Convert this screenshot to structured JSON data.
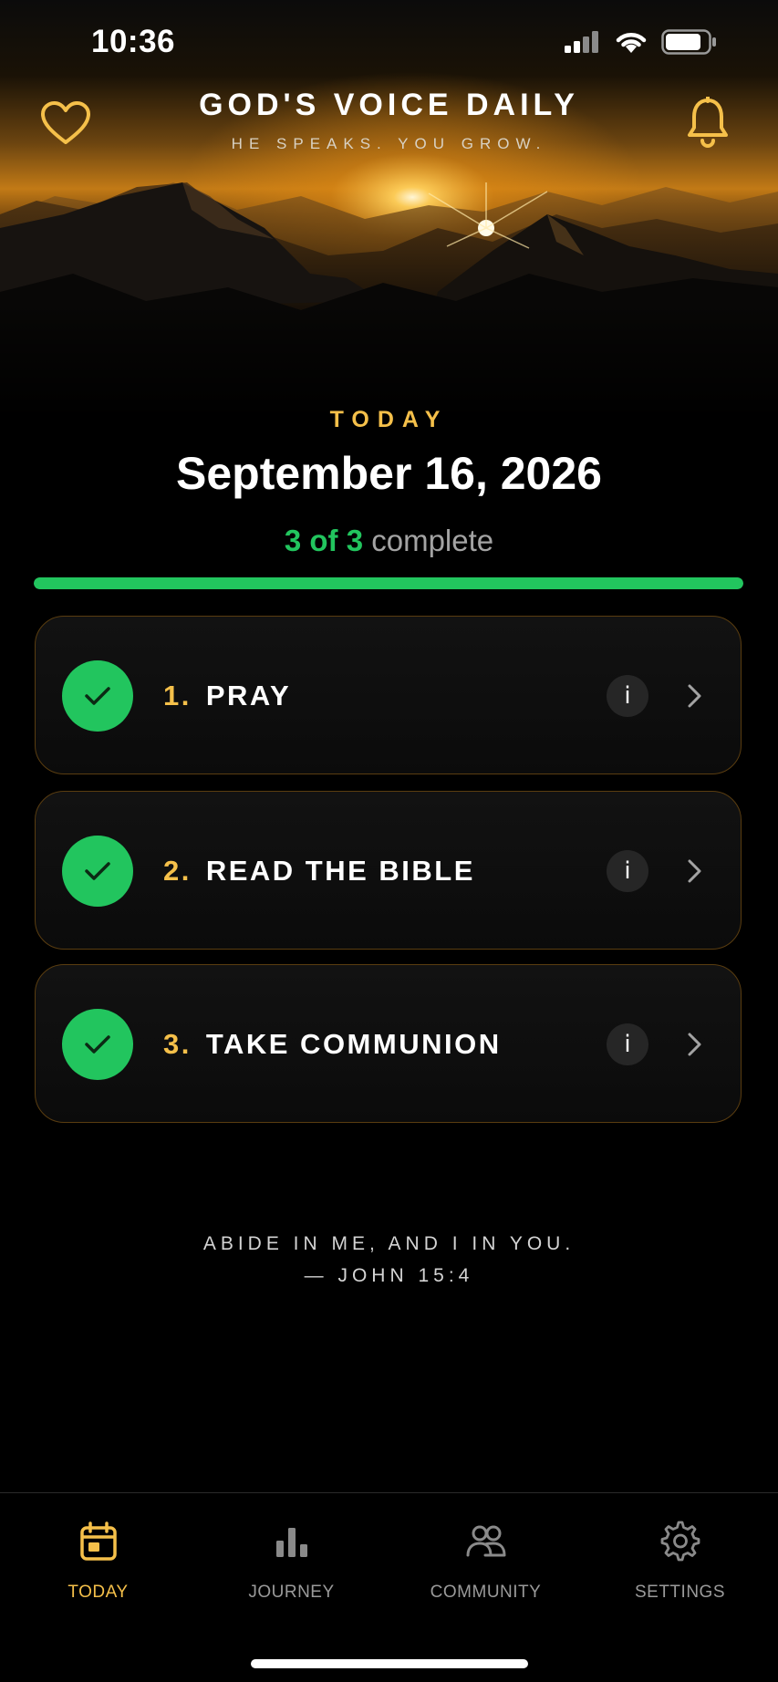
{
  "status_bar": {
    "time": "10:36"
  },
  "header": {
    "title": "GOD'S VOICE DAILY",
    "tagline": "HE SPEAKS. YOU GROW.",
    "favorite_icon": "heart-outline-icon",
    "notifications_icon": "bell-icon"
  },
  "today": {
    "label": "TODAY",
    "date": "September 16, 2026",
    "progress": {
      "done_text": "3 of 3",
      "rest_text": "complete",
      "completed": 3,
      "total": 3,
      "fraction": 1.0
    }
  },
  "tasks": [
    {
      "number": "1.",
      "title": "PRAY",
      "completed": true,
      "info": "i"
    },
    {
      "number": "2.",
      "title": "READ THE BIBLE",
      "completed": true,
      "info": "i"
    },
    {
      "number": "3.",
      "title": "TAKE COMMUNION",
      "completed": true,
      "info": "i"
    }
  ],
  "verse": {
    "text": "ABIDE IN ME, AND I IN YOU.",
    "reference": "— JOHN 15:4"
  },
  "tab_bar": {
    "items": [
      {
        "label": "TODAY",
        "icon": "calendar-icon",
        "active": true
      },
      {
        "label": "JOURNEY",
        "icon": "bar-chart-icon",
        "active": false
      },
      {
        "label": "COMMUNITY",
        "icon": "people-icon",
        "active": false
      },
      {
        "label": "SETTINGS",
        "icon": "gear-icon",
        "active": false
      }
    ]
  },
  "colors": {
    "accent_gold": "#f5c04a",
    "success_green": "#22c55e",
    "card_border": "#5a3d10",
    "background": "#000000"
  }
}
